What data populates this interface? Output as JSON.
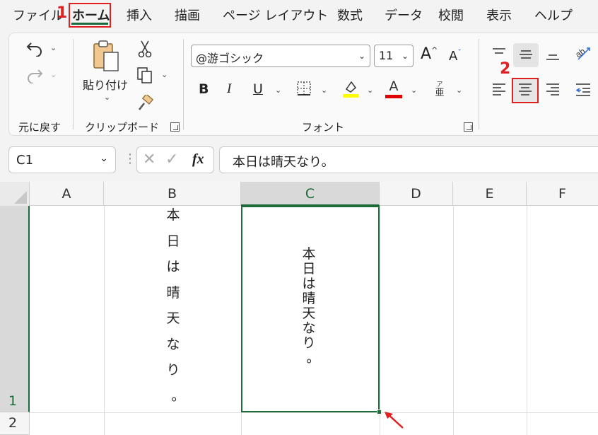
{
  "menu": {
    "tabs": [
      "ファイル",
      "ホーム",
      "挿入",
      "描画",
      "ページ レイアウト",
      "数式",
      "データ",
      "校閲",
      "表示",
      "ヘルプ"
    ],
    "active": "ホーム"
  },
  "annotations": {
    "step1": "1",
    "step2": "2"
  },
  "ribbon": {
    "undo_group_label": "元に戻す",
    "clipboard_group_label": "クリップボード",
    "paste_label": "貼り付け",
    "font_group_label": "フォント",
    "font_name": "@游ゴシック",
    "font_size": "11",
    "bold": "B",
    "italic": "I",
    "underline": "U",
    "font_color_glyph": "A",
    "phonetic_glyph": "ア",
    "grow_font_glyph": "A",
    "shrink_font_glyph": "A",
    "accent_colors": {
      "highlight": "#ffff00",
      "font_color": "#e00000",
      "excel_green": "#1e6b3a"
    }
  },
  "formula_bar": {
    "name_box": "C1",
    "fx_label": "fx",
    "formula": "本日は晴天なり。"
  },
  "grid": {
    "columns": [
      "A",
      "B",
      "C",
      "D",
      "E",
      "F"
    ],
    "selected_column": "C",
    "rows": [
      "1",
      "2"
    ],
    "selected_row": "1",
    "cells": {
      "B1": [
        "本",
        "日",
        "は",
        "晴",
        "天",
        "な",
        "り",
        "。"
      ],
      "C1": [
        "本",
        "日",
        "は",
        "晴",
        "天",
        "な",
        "り",
        "。"
      ]
    }
  }
}
